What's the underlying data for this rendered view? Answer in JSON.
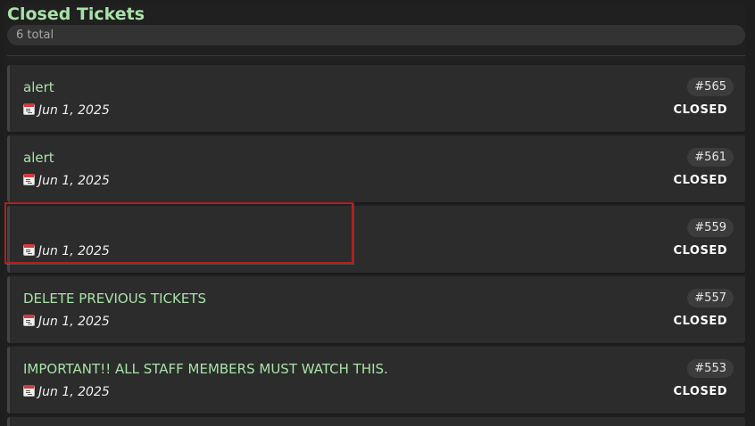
{
  "header": {
    "title": "Closed Tickets",
    "total": "6 total"
  },
  "tickets": [
    {
      "title": "alert",
      "date": "Jun 1, 2025",
      "id": "#565",
      "status": "CLOSED"
    },
    {
      "title": "alert",
      "date": "Jun 1, 2025",
      "id": "#561",
      "status": "CLOSED"
    },
    {
      "title": "",
      "date": "Jun 1, 2025",
      "id": "#559",
      "status": "CLOSED"
    },
    {
      "title": "DELETE PREVIOUS TICKETS",
      "date": "Jun 1, 2025",
      "id": "#557",
      "status": "CLOSED"
    },
    {
      "title": "IMPORTANT!! ALL STAFF MEMBERS MUST WATCH THIS.",
      "date": "Jun 1, 2025",
      "id": "#553",
      "status": "CLOSED"
    }
  ],
  "icons": {
    "date": "calendar-icon"
  },
  "colors": {
    "title_green": "#a8e2a8",
    "highlight_red": "#b21f1f",
    "card_bg": "#2c2c2c"
  }
}
